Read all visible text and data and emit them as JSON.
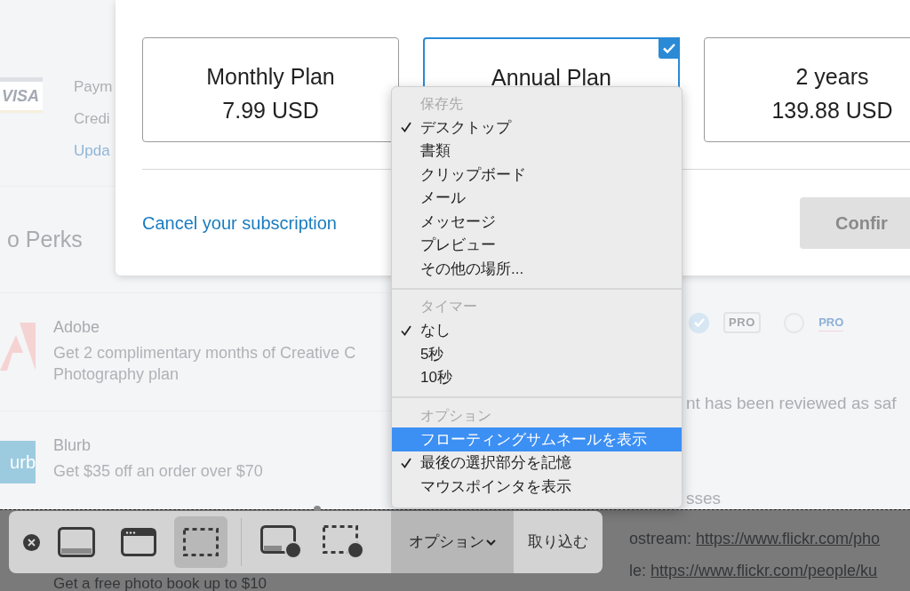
{
  "page": {
    "payment": {
      "card_label": "VISA",
      "title": "Paym",
      "subtitle": "Credi",
      "link": "Upda"
    },
    "perks_title": "o Perks",
    "perks": [
      {
        "kind": "adobe",
        "name": "Adobe",
        "description_lines": [
          "Get 2 complimentary months of Creative C",
          "Photography plan"
        ]
      },
      {
        "kind": "blurb",
        "logo_text": "urb",
        "name": "Blurb",
        "description_lines": [
          "Get $35 off an order over $70"
        ]
      }
    ],
    "pro_options": [
      {
        "selected": true,
        "kind": "box",
        "label": "PRO"
      },
      {
        "selected": false,
        "kind": "link",
        "label": "PRO"
      }
    ],
    "notice": "nt has been reviewed as saf",
    "section_title": "sses",
    "links": [
      {
        "label": "ostream: ",
        "url": "https://www.flickr.com/pho"
      },
      {
        "label": "le: ",
        "url": "https://www.flickr.com/people/ku"
      }
    ],
    "footer_perk": "Get a free photo book up to $10"
  },
  "modal": {
    "plans": [
      {
        "name": "Monthly Plan",
        "price": "7.99 USD",
        "selected": false
      },
      {
        "name": "Annual Plan",
        "selected": true
      },
      {
        "name": "2 years",
        "price": "139.88 USD",
        "selected": false
      }
    ],
    "cancel_link": "Cancel your subscription",
    "confirm_button": "Confir"
  },
  "menu": {
    "sections": [
      {
        "header": "保存先",
        "items": [
          {
            "label": "デスクトップ",
            "checked": true,
            "selected": false
          },
          {
            "label": "書類",
            "checked": false,
            "selected": false
          },
          {
            "label": "クリップボード",
            "checked": false,
            "selected": false
          },
          {
            "label": "メール",
            "checked": false,
            "selected": false
          },
          {
            "label": "メッセージ",
            "checked": false,
            "selected": false
          },
          {
            "label": "プレビュー",
            "checked": false,
            "selected": false
          },
          {
            "label": "その他の場所...",
            "checked": false,
            "selected": false
          }
        ]
      },
      {
        "header": "タイマー",
        "items": [
          {
            "label": "なし",
            "checked": true,
            "selected": false
          },
          {
            "label": "5秒",
            "checked": false,
            "selected": false
          },
          {
            "label": "10秒",
            "checked": false,
            "selected": false
          }
        ]
      },
      {
        "header": "オプション",
        "items": [
          {
            "label": "フローティングサムネールを表示",
            "checked": false,
            "selected": true
          },
          {
            "label": "最後の選択部分を記憶",
            "checked": true,
            "selected": false
          },
          {
            "label": "マウスポインタを表示",
            "checked": false,
            "selected": false
          }
        ]
      }
    ]
  },
  "toolbar": {
    "tool_groups": [
      [
        {
          "kind": "screen",
          "selected": false
        },
        {
          "kind": "window",
          "selected": false
        },
        {
          "kind": "selection",
          "selected": true
        }
      ],
      [
        {
          "kind": "record-screen",
          "selected": false
        },
        {
          "kind": "record-selection",
          "selected": false
        }
      ]
    ],
    "options_button": "オプション",
    "capture_button": "取り込む"
  }
}
